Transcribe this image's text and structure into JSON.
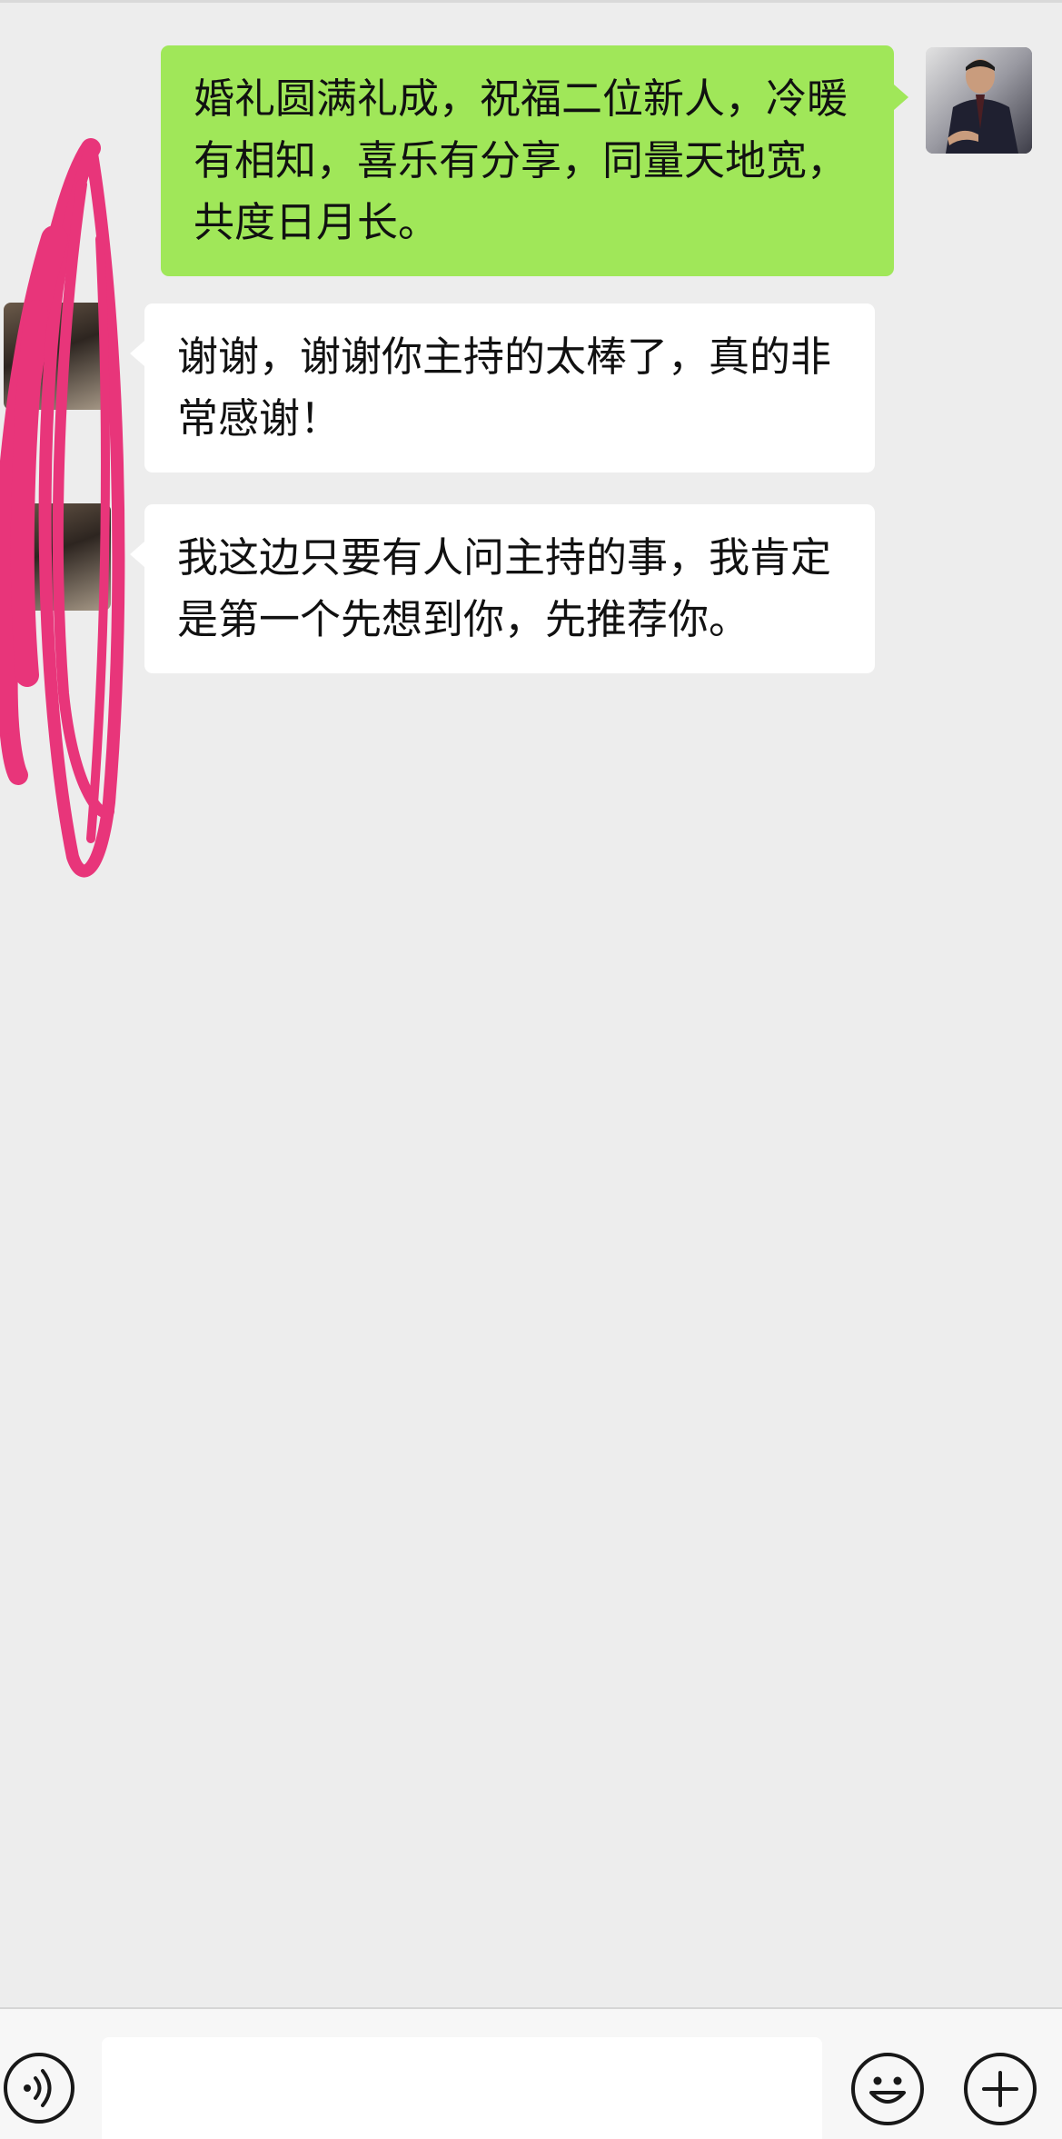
{
  "conversation": {
    "messages": [
      {
        "direction": "sent",
        "text": "婚礼圆满礼成，祝福二位新人，冷暖有相知，喜乐有分享，同量天地宽，共度日月长。"
      },
      {
        "direction": "received",
        "text": "谢谢，谢谢你主持的太棒了，真的非常感谢！"
      },
      {
        "direction": "received",
        "text": "我这边只要有人问主持的事，我肯定是第一个先想到你，先推荐你。"
      }
    ]
  },
  "input_bar": {
    "message_value": "",
    "icons": {
      "voice": "voice-icon",
      "emoji": "emoji-icon",
      "more": "plus-icon"
    }
  },
  "colors": {
    "background": "#ededed",
    "sent_bubble": "#a0e759",
    "received_bubble": "#ffffff",
    "scribble": "#e8357a"
  }
}
